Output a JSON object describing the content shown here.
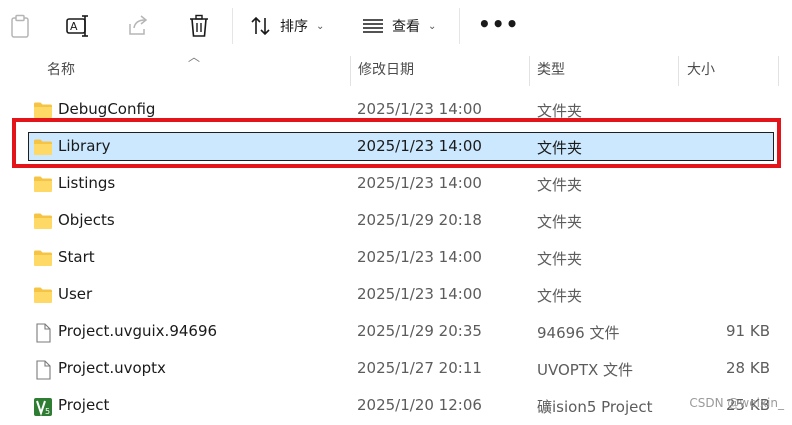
{
  "colors": {
    "selection": "#cce8ff",
    "highlight_box": "#e3141a",
    "folder": "#f4c542"
  },
  "toolbar": {
    "icons": [
      "paste-icon",
      "rename-icon",
      "share-icon",
      "delete-icon"
    ],
    "sort_label": "排序",
    "view_label": "查看",
    "more_label": "•••"
  },
  "columns": {
    "name": "名称",
    "date": "修改日期",
    "type": "类型",
    "size": "大小"
  },
  "files": [
    {
      "name": "DebugConfig",
      "date": "2025/1/23 14:00",
      "type": "文件夹",
      "size": "",
      "icon": "folder-icon"
    },
    {
      "name": "Library",
      "date": "2025/1/23 14:00",
      "type": "文件夹",
      "size": "",
      "icon": "folder-icon",
      "selected": true
    },
    {
      "name": "Listings",
      "date": "2025/1/23 14:00",
      "type": "文件夹",
      "size": "",
      "icon": "folder-icon"
    },
    {
      "name": "Objects",
      "date": "2025/1/29 20:18",
      "type": "文件夹",
      "size": "",
      "icon": "folder-icon"
    },
    {
      "name": "Start",
      "date": "2025/1/23 14:00",
      "type": "文件夹",
      "size": "",
      "icon": "folder-icon"
    },
    {
      "name": "User",
      "date": "2025/1/23 14:00",
      "type": "文件夹",
      "size": "",
      "icon": "folder-icon"
    },
    {
      "name": "Project.uvguix.94696",
      "date": "2025/1/29 20:35",
      "type": "94696 文件",
      "size": "91 KB",
      "icon": "file-icon"
    },
    {
      "name": "Project.uvoptx",
      "date": "2025/1/27 20:11",
      "type": "UVOPTX 文件",
      "size": "28 KB",
      "icon": "file-icon"
    },
    {
      "name": "Project",
      "date": "2025/1/20 12:06",
      "type": "礦ision5 Project",
      "size": "25 KB",
      "icon": "uvision-project-icon"
    }
  ],
  "watermark": "CSDN @weixin_"
}
